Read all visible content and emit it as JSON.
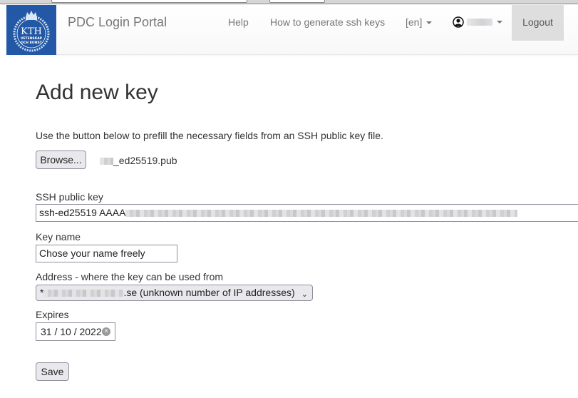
{
  "navbar": {
    "logo_text": "KTH",
    "logo_subtext_1": "VETENSKAP",
    "logo_subtext_2": "OCH KONST",
    "brand": "PDC Login Portal",
    "links": [
      {
        "label": "Help"
      },
      {
        "label": "How to generate ssh keys"
      }
    ],
    "language": "[en]",
    "user_icon": "user-circle-icon",
    "logout_label": "Logout"
  },
  "page": {
    "title": "Add new key",
    "intro": "Use the button below to prefill the necessary fields from an SSH public key file.",
    "browse_label": "Browse...",
    "file_name_suffix": "_ed25519.pub"
  },
  "form": {
    "ssh_key_label": "SSH public key",
    "ssh_key_value_prefix": "ssh-ed25519 AAAA",
    "key_name_label": "Key name",
    "key_name_value": "Chose your name freely",
    "address_label": "Address - where the key can be used from",
    "address_prefix": "*",
    "address_suffix": ".se (unknown number of IP addresses)",
    "expires_label": "Expires",
    "expires_value": "31 / 10 / 2022",
    "save_label": "Save"
  },
  "colors": {
    "logo_blue": "#2258a5",
    "logout_bg": "#dedede",
    "nav_text": "#777777"
  }
}
